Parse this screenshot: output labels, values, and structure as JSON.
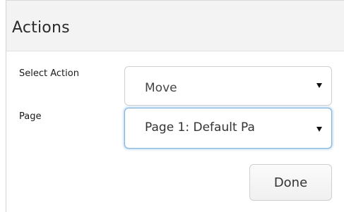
{
  "header": {
    "title": "Actions"
  },
  "form": {
    "select_action": {
      "label": "Select Action",
      "value": "Move"
    },
    "page": {
      "label": "Page",
      "value": "Page 1:  Default Pa"
    },
    "done_label": "Done"
  },
  "colors": {
    "header_bg": "#f3f3f3",
    "focus_border": "#7fb3dc"
  }
}
